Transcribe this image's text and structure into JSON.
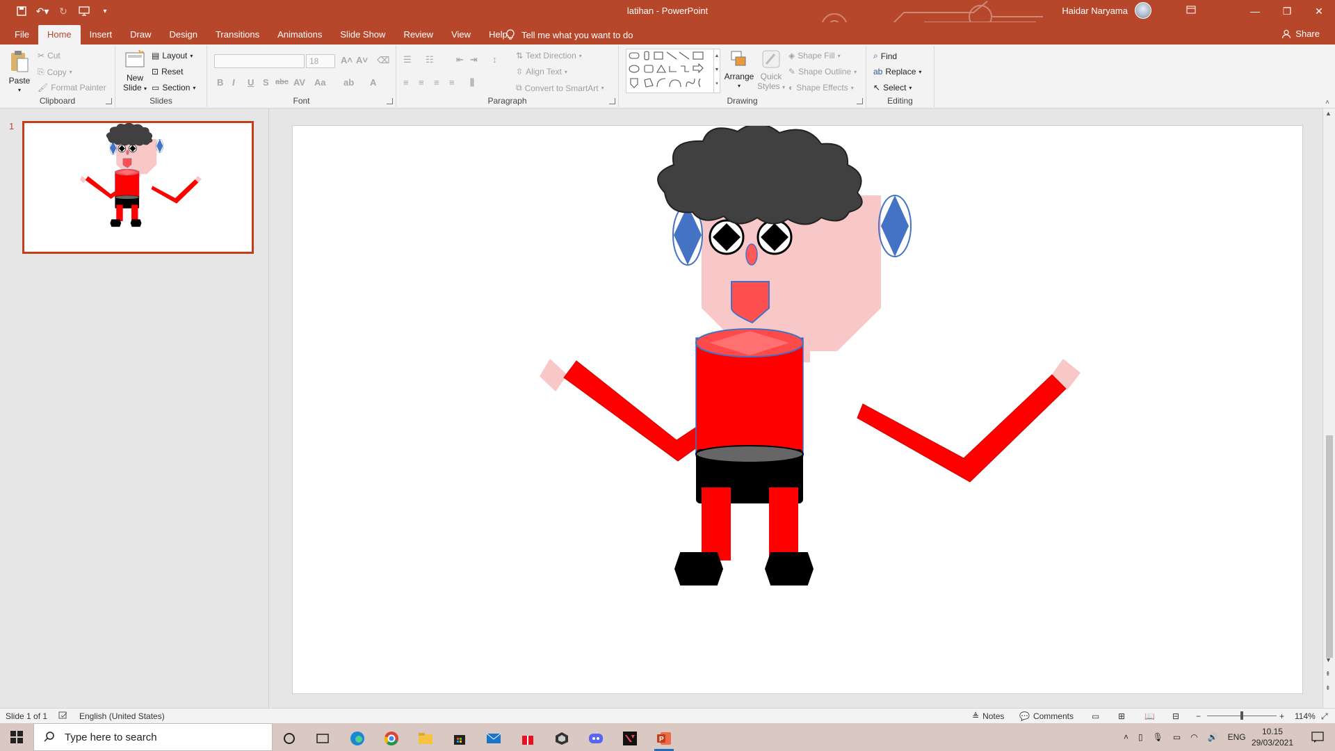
{
  "window": {
    "doc_title": "latihan  -  PowerPoint",
    "user_name": "Haidar Naryama",
    "accent": "#b7472a"
  },
  "tabs": [
    "File",
    "Home",
    "Insert",
    "Draw",
    "Design",
    "Transitions",
    "Animations",
    "Slide Show",
    "Review",
    "View",
    "Help"
  ],
  "active_tab": "Home",
  "tell_me": "Tell me what you want to do",
  "share": "Share",
  "ribbon": {
    "clipboard": {
      "label": "Clipboard",
      "paste": "Paste",
      "cut": "Cut",
      "copy": "Copy",
      "format_painter": "Format Painter"
    },
    "slides": {
      "label": "Slides",
      "new_slide": "New",
      "new_slide2": "Slide",
      "layout": "Layout",
      "reset": "Reset",
      "section": "Section"
    },
    "font": {
      "label": "Font",
      "font_name": "",
      "font_size": "18"
    },
    "paragraph": {
      "label": "Paragraph",
      "text_direction": "Text Direction",
      "align_text": "Align Text",
      "convert_smartart": "Convert to SmartArt"
    },
    "drawing": {
      "label": "Drawing",
      "arrange": "Arrange",
      "quick_styles": "Quick",
      "quick_styles2": "Styles",
      "shape_fill": "Shape Fill",
      "shape_outline": "Shape Outline",
      "shape_effects": "Shape Effects"
    },
    "editing": {
      "label": "Editing",
      "find": "Find",
      "replace": "Replace",
      "select": "Select"
    }
  },
  "thumbnail": {
    "number": "1"
  },
  "status": {
    "slide_info": "Slide 1 of 1",
    "language": "English (United States)",
    "notes": "Notes",
    "comments": "Comments",
    "zoom": "114%"
  },
  "taskbar": {
    "search_placeholder": "Type here to search",
    "lang": "ENG",
    "time": "10.15",
    "date": "29/03/2021"
  }
}
